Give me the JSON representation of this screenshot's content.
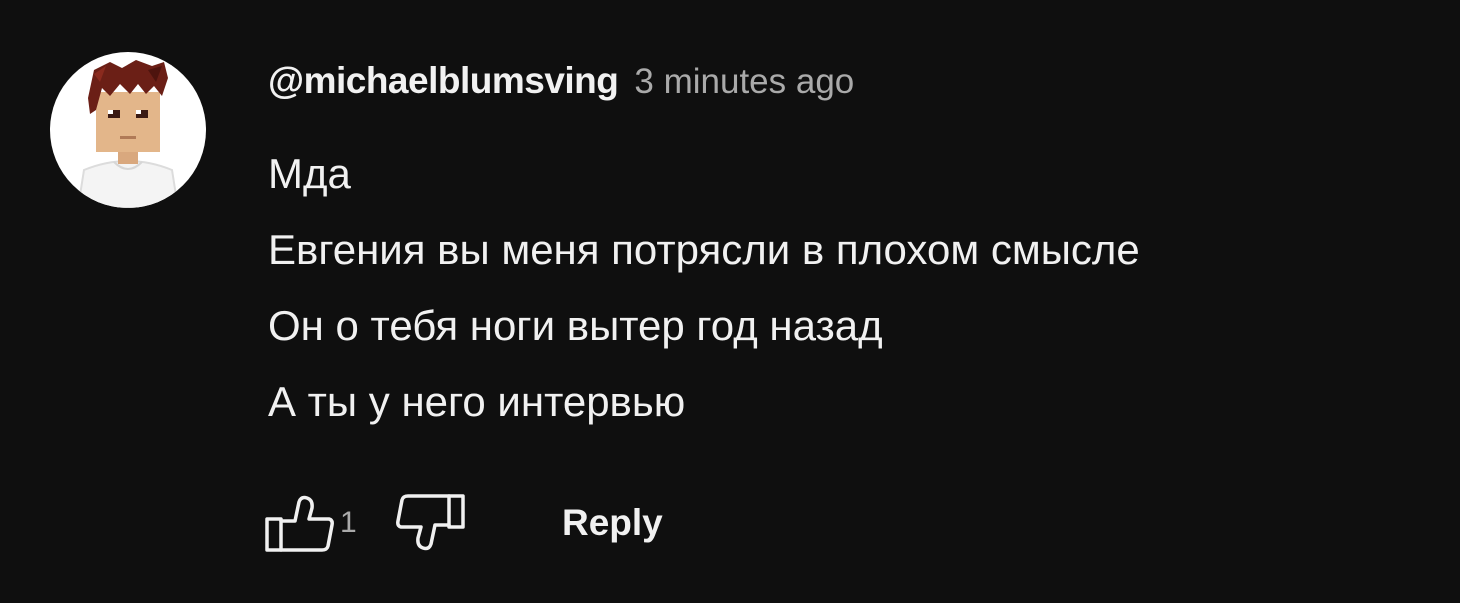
{
  "comment": {
    "author": "@michaelblumsving",
    "time": "3 minutes ago",
    "lines": [
      "Мда",
      "Евгения вы меня потрясли в плохом смысле",
      "Он о тебя ноги вытер год назад",
      "А ты у него интервью"
    ],
    "like_count": "1",
    "reply_label": "Reply"
  },
  "icons": {
    "like": "thumbs-up-outline-icon",
    "dislike": "thumbs-down-outline-icon"
  },
  "colors": {
    "background": "#0f0f0f",
    "primary_text": "#f1f1f1",
    "secondary_text": "#aaaaaa",
    "avatar_bg": "#ffffff"
  }
}
